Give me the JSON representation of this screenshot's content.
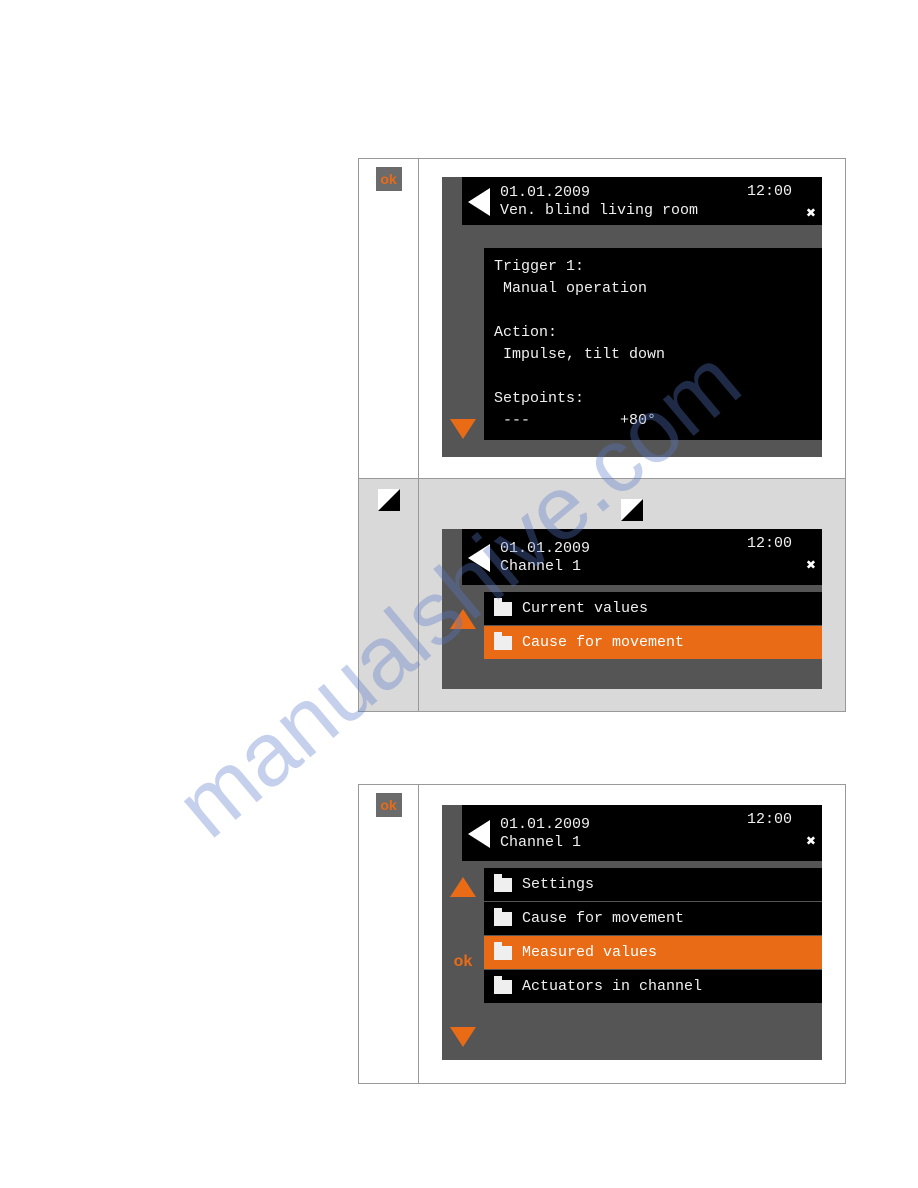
{
  "watermark": "manualshive.com",
  "buttons": {
    "ok": "ok"
  },
  "panel1": {
    "date": "01.01.2009",
    "time": "12:00",
    "title": "Ven. blind living room",
    "body": "Trigger 1:\n Manual operation\n\nAction:\n Impulse, tilt down\n\nSetpoints:\n ---          +80°"
  },
  "panel2": {
    "date": "01.01.2009",
    "time": "12:00",
    "title": "Channel 1",
    "items": [
      {
        "label": "Current values",
        "selected": false
      },
      {
        "label": "Cause for movement",
        "selected": true
      }
    ]
  },
  "panel3": {
    "date": "01.01.2009",
    "time": "12:00",
    "title": "Channel 1",
    "items": [
      {
        "label": "Settings",
        "selected": false
      },
      {
        "label": "Cause for movement",
        "selected": false
      },
      {
        "label": "Measured values",
        "selected": true
      },
      {
        "label": "Actuators in channel",
        "selected": false
      }
    ]
  }
}
